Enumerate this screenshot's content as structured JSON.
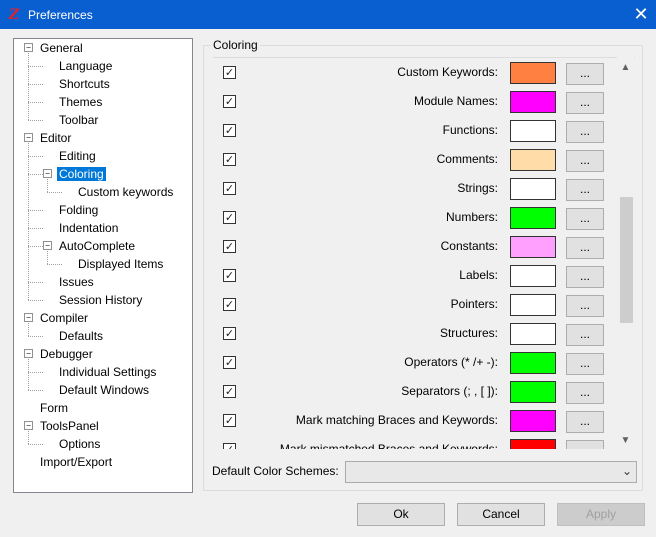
{
  "window": {
    "title": "Preferences"
  },
  "tree": [
    {
      "label": "General",
      "level": 0,
      "expanded": true
    },
    {
      "label": "Language",
      "level": 1
    },
    {
      "label": "Shortcuts",
      "level": 1
    },
    {
      "label": "Themes",
      "level": 1
    },
    {
      "label": "Toolbar",
      "level": 1
    },
    {
      "label": "Editor",
      "level": 0,
      "expanded": true
    },
    {
      "label": "Editing",
      "level": 1
    },
    {
      "label": "Coloring",
      "level": 1,
      "expanded": true,
      "selected": true
    },
    {
      "label": "Custom keywords",
      "level": 2
    },
    {
      "label": "Folding",
      "level": 1
    },
    {
      "label": "Indentation",
      "level": 1
    },
    {
      "label": "AutoComplete",
      "level": 1,
      "expanded": true
    },
    {
      "label": "Displayed Items",
      "level": 2
    },
    {
      "label": "Issues",
      "level": 1
    },
    {
      "label": "Session History",
      "level": 1
    },
    {
      "label": "Compiler",
      "level": 0,
      "expanded": true
    },
    {
      "label": "Defaults",
      "level": 1
    },
    {
      "label": "Debugger",
      "level": 0,
      "expanded": true
    },
    {
      "label": "Individual Settings",
      "level": 1
    },
    {
      "label": "Default Windows",
      "level": 1
    },
    {
      "label": "Form",
      "level": 0
    },
    {
      "label": "ToolsPanel",
      "level": 0,
      "expanded": true
    },
    {
      "label": "Options",
      "level": 1
    },
    {
      "label": "Import/Export",
      "level": 0
    }
  ],
  "coloring": {
    "group_label": "Coloring",
    "browse_label": "...",
    "items": [
      {
        "label": "Custom Keywords:",
        "color": "#ff8040",
        "checked": true
      },
      {
        "label": "Module Names:",
        "color": "#ff00ff",
        "checked": true
      },
      {
        "label": "Functions:",
        "color": "#ffffff",
        "checked": true
      },
      {
        "label": "Comments:",
        "color": "#ffdca8",
        "checked": true
      },
      {
        "label": "Strings:",
        "color": "#ffffff",
        "checked": true
      },
      {
        "label": "Numbers:",
        "color": "#00ff00",
        "checked": true
      },
      {
        "label": "Constants:",
        "color": "#ffa0ff",
        "checked": true
      },
      {
        "label": "Labels:",
        "color": "#ffffff",
        "checked": true
      },
      {
        "label": "Pointers:",
        "color": "#ffffff",
        "checked": true
      },
      {
        "label": "Structures:",
        "color": "#ffffff",
        "checked": true
      },
      {
        "label": "Operators (* /+ -):",
        "color": "#00ff00",
        "checked": true
      },
      {
        "label": "Separators (; , [ ]):",
        "color": "#00ff00",
        "checked": true
      },
      {
        "label": "Mark matching Braces and Keywords:",
        "color": "#ff00ff",
        "checked": true
      },
      {
        "label": "Mark mismatched Braces and Keywords:",
        "color": "#ff0000",
        "checked": true
      }
    ]
  },
  "scheme": {
    "label": "Default Color Schemes:",
    "value": ""
  },
  "buttons": {
    "ok": "Ok",
    "cancel": "Cancel",
    "apply": "Apply"
  }
}
